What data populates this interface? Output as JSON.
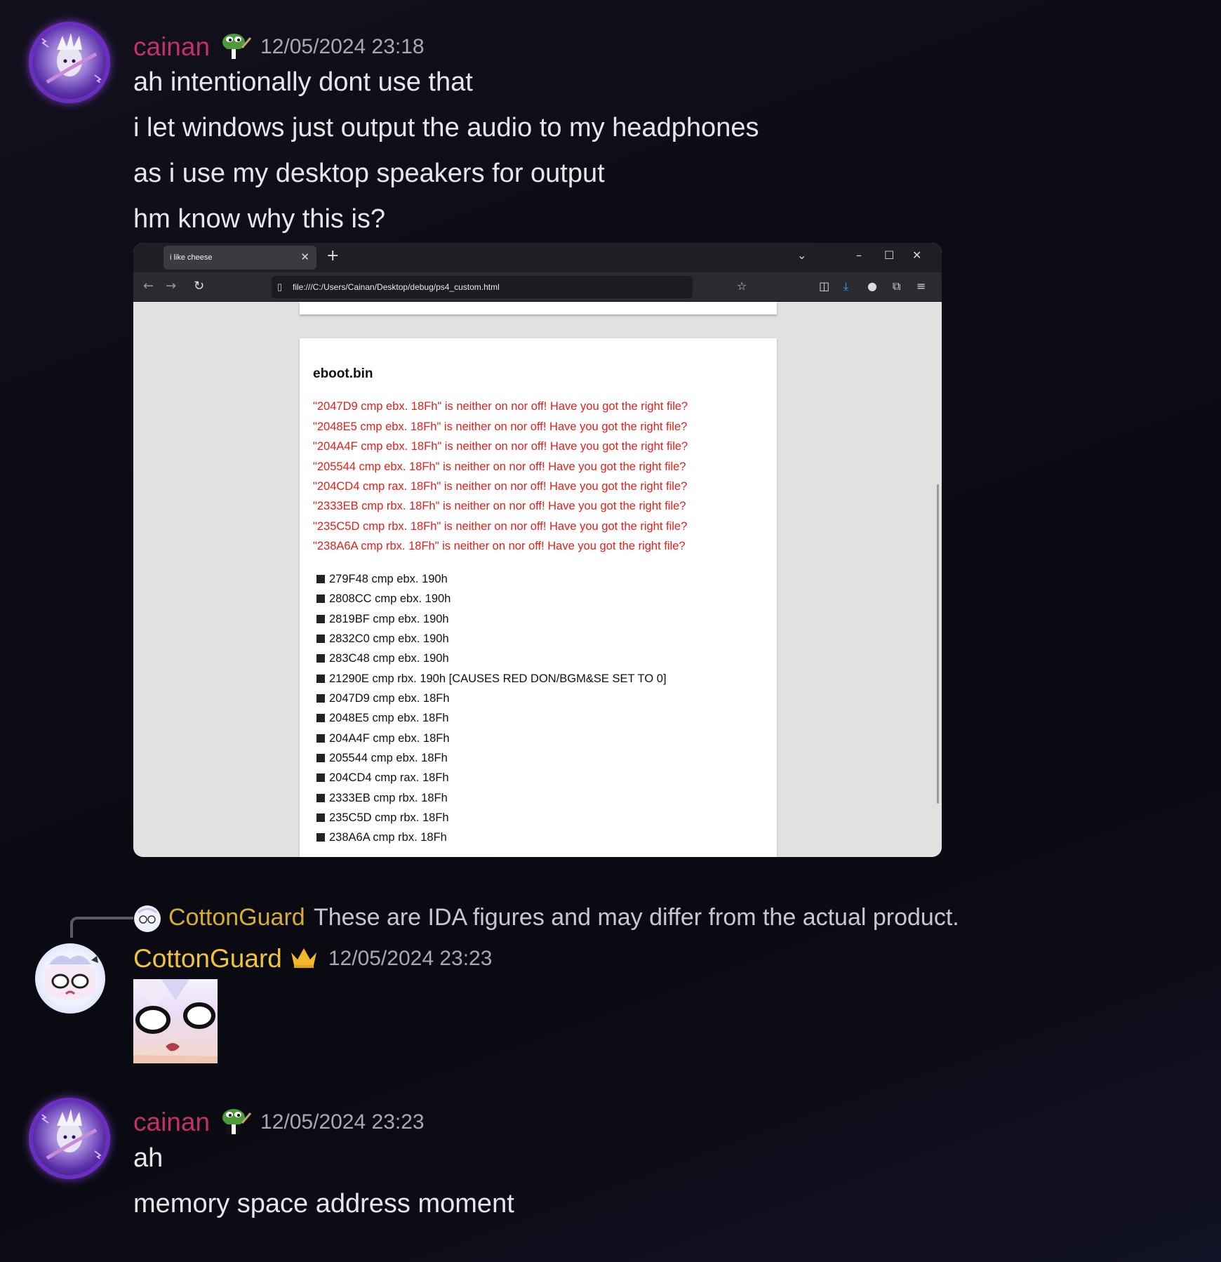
{
  "messages": [
    {
      "author": "cainan",
      "timestamp": "12/05/2024 23:18",
      "lines": [
        "ah intentionally dont use that",
        "i let windows just output the audio to my headphones",
        "as i use my desktop speakers for output",
        "hm know why this is?"
      ]
    },
    {
      "author": "CottonGuard",
      "timestamp": "12/05/2024 23:23"
    },
    {
      "author": "cainan",
      "timestamp": "12/05/2024 23:23",
      "lines": [
        "ah",
        "memory space address moment"
      ]
    }
  ],
  "reply": {
    "author": "CottonGuard",
    "text": "These are IDA figures and may differ from the actual product."
  },
  "attachment": {
    "tab_title": "i like cheese",
    "url": "file:///C:/Users/Cainan/Desktop/debug/ps4_custom.html",
    "card_title": "eboot.bin",
    "errors": [
      "\"2047D9 cmp ebx. 18Fh\" is neither on nor off! Have you got the right file?",
      "\"2048E5 cmp ebx. 18Fh\" is neither on nor off! Have you got the right file?",
      "\"204A4F cmp ebx. 18Fh\" is neither on nor off! Have you got the right file?",
      "\"205544 cmp ebx. 18Fh\" is neither on nor off! Have you got the right file?",
      "\"204CD4 cmp rax. 18Fh\" is neither on nor off! Have you got the right file?",
      "\"2333EB cmp rbx. 18Fh\" is neither on nor off! Have you got the right file?",
      "\"235C5D cmp rbx. 18Fh\" is neither on nor off! Have you got the right file?",
      "\"238A6A cmp rbx. 18Fh\" is neither on nor off! Have you got the right file?"
    ],
    "items": [
      "279F48 cmp ebx. 190h",
      "2808CC cmp ebx. 190h",
      "2819BF cmp ebx. 190h",
      "2832C0 cmp ebx. 190h",
      "283C48 cmp ebx. 190h",
      "21290E cmp rbx. 190h [CAUSES RED DON/BGM&SE SET TO 0]",
      "2047D9 cmp ebx. 18Fh",
      "2048E5 cmp ebx. 18Fh",
      "204A4F cmp ebx. 18Fh",
      "205544 cmp ebx. 18Fh",
      "204CD4 cmp rax. 18Fh",
      "2333EB cmp rbx. 18Fh",
      "235C5D cmp rbx. 18Fh",
      "238A6A cmp rbx. 18Fh"
    ]
  },
  "icons": {
    "badge_cainan": "pepe-emoji-icon",
    "badge_cotton": "crown-icon"
  },
  "colors": {
    "cainan": "#c2306b",
    "cotton": "#f0c33c",
    "error": "#e3201b"
  }
}
